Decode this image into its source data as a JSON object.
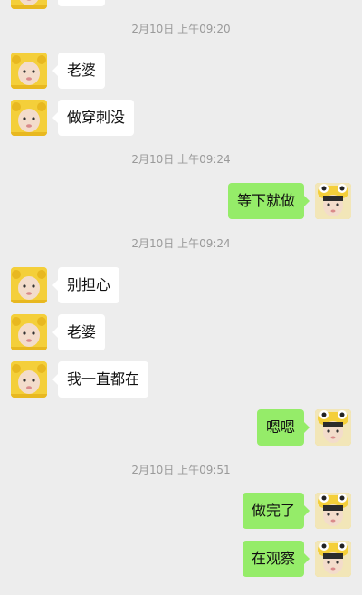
{
  "chat": {
    "timestamps": [
      "2月10日 上午09:20",
      "2月10日 上午09:24",
      "2月10日 上午09:24",
      "2月10日 上午09:51"
    ],
    "messages": [
      {
        "text": "老婆",
        "direction": "incoming"
      },
      {
        "text": "做穿刺没",
        "direction": "incoming"
      },
      {
        "text": "等下就做",
        "direction": "outgoing"
      },
      {
        "text": "别担心",
        "direction": "incoming"
      },
      {
        "text": "老婆",
        "direction": "incoming"
      },
      {
        "text": "我一直都在",
        "direction": "incoming"
      },
      {
        "text": "嗯嗯",
        "direction": "outgoing"
      },
      {
        "text": "做完了",
        "direction": "outgoing"
      },
      {
        "text": "在观察",
        "direction": "outgoing"
      }
    ]
  },
  "colors": {
    "background": "#ededed",
    "incoming_bubble": "#ffffff",
    "outgoing_bubble": "#95ec69",
    "timestamp_text": "#9a9a9a"
  },
  "icons": {
    "contact_avatar": "baby-in-yellow-hood-avatar",
    "self_avatar": "child-in-frog-hat-avatar"
  }
}
